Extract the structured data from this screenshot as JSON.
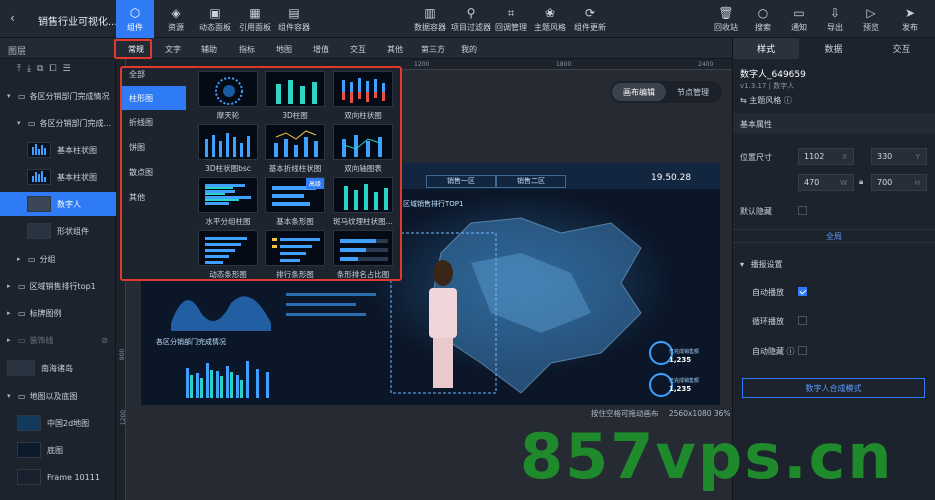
{
  "app": {
    "title": "销售行业可视化...",
    "back_icon": "chevron-left-icon"
  },
  "toolbar_left": [
    {
      "label": "组件",
      "icon": "hexagon-icon",
      "active": true
    },
    {
      "label": "资源",
      "icon": "layers-icon"
    },
    {
      "label": "动态面板",
      "icon": "panel-icon"
    },
    {
      "label": "引用面板",
      "icon": "grid-icon"
    },
    {
      "label": "组件容器",
      "icon": "container-icon"
    }
  ],
  "toolbar_center": [
    {
      "label": "数据容器",
      "icon": "data-icon"
    },
    {
      "label": "项目过滤器",
      "icon": "filter-icon"
    },
    {
      "label": "回调管理",
      "icon": "callback-icon"
    },
    {
      "label": "主题风格",
      "icon": "theme-icon"
    },
    {
      "label": "组件更新",
      "icon": "update-icon"
    }
  ],
  "toolbar_right": [
    {
      "label": "回收站",
      "icon": "trash-icon"
    },
    {
      "label": "搜索",
      "icon": "search-icon"
    },
    {
      "label": "通知",
      "icon": "bell-icon"
    },
    {
      "label": "导出",
      "icon": "export-icon"
    },
    {
      "label": "预览",
      "icon": "preview-icon"
    },
    {
      "label": "发布",
      "icon": "send-icon"
    }
  ],
  "layers_header": "图层",
  "category_tabs": [
    "常规",
    "文字",
    "辅助",
    "指标",
    "地图",
    "增值",
    "交互",
    "其他",
    "第三方",
    "我的"
  ],
  "layers": [
    {
      "label": "各区分销部门完成情况",
      "type": "group"
    },
    {
      "label": "各区分销部门完成...",
      "type": "group"
    },
    {
      "label": "基本柱状图",
      "type": "item"
    },
    {
      "label": "基本柱状图",
      "type": "item"
    },
    {
      "label": "数字人",
      "type": "item",
      "selected": true
    },
    {
      "label": "形状组件",
      "type": "item"
    },
    {
      "label": "分组",
      "type": "group"
    },
    {
      "label": "区域销售排行top1",
      "type": "group"
    },
    {
      "label": "标牌图例",
      "type": "group"
    },
    {
      "label": "装饰线",
      "type": "group",
      "dim": true
    },
    {
      "label": "南海诸岛",
      "type": "item"
    },
    {
      "label": "地图以及底图",
      "type": "group"
    },
    {
      "label": "中国2d地图",
      "type": "item"
    },
    {
      "label": "底图",
      "type": "item"
    },
    {
      "label": "Frame 10111",
      "type": "item"
    }
  ],
  "popup": {
    "categories": [
      "全部",
      "柱形图",
      "折线图",
      "饼图",
      "散点图",
      "其他"
    ],
    "items": [
      {
        "label": "摩天轮"
      },
      {
        "label": "3D柱图"
      },
      {
        "label": "双向柱状图"
      },
      {
        "label": "3D柱状图bsc"
      },
      {
        "label": "基本折线柱状图"
      },
      {
        "label": "双向轴图表"
      },
      {
        "label": "水平分组柱图"
      },
      {
        "label": "基本条形图",
        "badge": "高级"
      },
      {
        "label": "斑马纹理柱状图..."
      },
      {
        "label": "动态条形图"
      },
      {
        "label": "排行条形图"
      },
      {
        "label": "条形排名占比图"
      }
    ]
  },
  "ruler": {
    "h_marks": [
      "1200",
      "1800",
      "2400"
    ],
    "v_marks": [
      "900",
      "1200"
    ]
  },
  "canvas_modes": [
    "画布编辑",
    "节点管理"
  ],
  "canvas_status": "按住空格可拖动画布",
  "canvas_size": "2560x1080 36%",
  "screen": {
    "tabs": [
      "销售一区",
      "销售二区"
    ],
    "time": "19.50.28",
    "banner": "区域销售排行TOP1",
    "section_title": "各区分销部门完成情况",
    "stats": [
      {
        "value": "1,235",
        "label": "已完成销售额"
      },
      {
        "value": "1,235",
        "label": "已完成销售额"
      }
    ]
  },
  "right": {
    "tabs": [
      "样式",
      "数据",
      "交互"
    ],
    "name": "数字人_649659",
    "version": "v1.3.17 | 数字人",
    "theme": "主题风格",
    "basic_header": "基本属性",
    "pos_label": "位置尺寸",
    "x": "1102",
    "y": "330",
    "w": "470",
    "h": "700",
    "x_unit": "X",
    "y_unit": "Y",
    "w_unit": "W",
    "h_unit": "H",
    "hide_label": "默认隐藏",
    "global": "全局",
    "play_header": "播报设置",
    "auto_play": "自动播放",
    "loop_play": "循环播放",
    "auto_hide": "自动隐藏",
    "synth_button": "数字人合成模式"
  },
  "watermark": "857vps.cn"
}
